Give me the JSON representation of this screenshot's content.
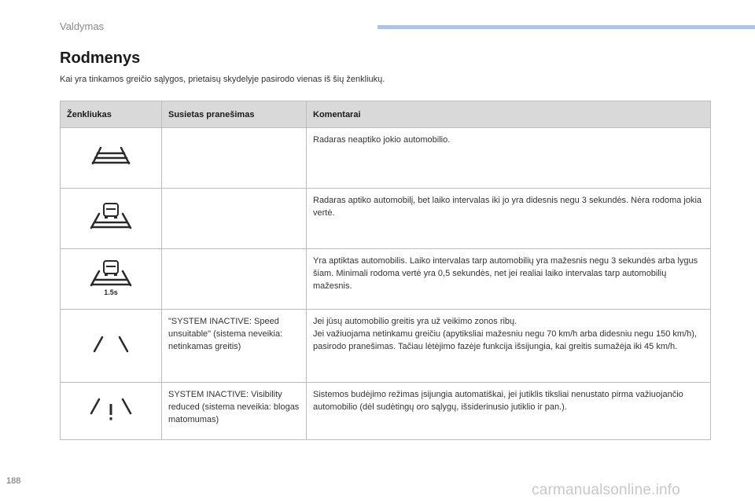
{
  "header": {
    "section": "Valdymas",
    "accent_color": "#a9c4e4"
  },
  "title": "Rodmenys",
  "intro": "Kai yra tinkamos greičio sąlygos, prietaisų skydelyje pasirodo vienas iš šių ženkliukų.",
  "table": {
    "columns": [
      "Ženkliukas",
      "Susietas pranešimas",
      "Komentarai"
    ],
    "rows": [
      {
        "icon": "road-lines-icon",
        "message": "",
        "comment": "Radaras neaptiko jokio automobilio."
      },
      {
        "icon": "road-car-icon",
        "message": "",
        "comment": "Radaras aptiko automobilį, bet laiko intervalas iki jo yra didesnis negu 3 sekundės. Nėra rodoma jokia vertė."
      },
      {
        "icon": "road-car-interval-icon",
        "icon_value": "1.5s",
        "message": "",
        "comment": "Yra aptiktas automobilis. Laiko intervalas tarp automobilių yra mažesnis negu 3 sekundės arba lygus šiam. Minimali rodoma vertė yra 0,5 sekundės, net jei realiai laiko intervalas tarp automobilių mažesnis."
      },
      {
        "icon": "road-edges-icon",
        "message": "\"SYSTEM INACTIVE: Speed unsuitable\" (sistema neveikia: netinkamas greitis)",
        "comment": "Jei jūsų automobilio greitis yra už veikimo zonos ribų.\nJei važiuojama netinkamu greičiu (apytiksliai mažesniu negu 70 km/h arba didesniu negu 150 km/h), pasirodo pranešimas. Tačiau lėtėjimo fazėje funkcija išsijungia, kai greitis sumažėja iki 45 km/h."
      },
      {
        "icon": "road-warning-icon",
        "message": "SYSTEM INACTIVE: Visibility reduced (sistema neveikia: blogas matomumas)",
        "comment": "Sistemos budėjimo režimas įsijungia automatiškai, jei jutiklis tiksliai nenustato pirma važiuojančio automobilio (dėl sudėtingų oro sąlygų, išsiderinusio jutiklio ir pan.)."
      }
    ]
  },
  "page_number": "188",
  "watermark": "carmanualsonline.info"
}
